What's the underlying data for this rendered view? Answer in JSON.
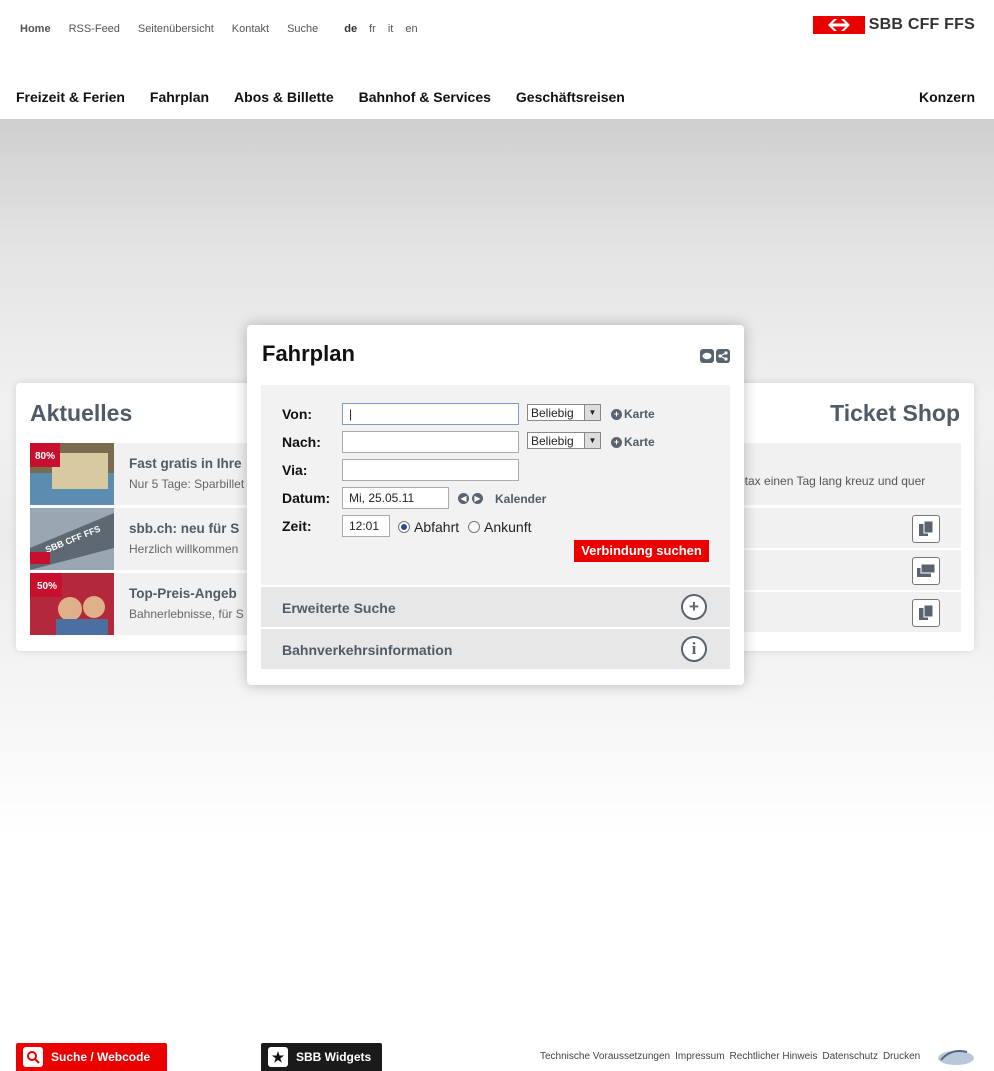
{
  "header": {
    "meta_links": [
      "Home",
      "RSS-Feed",
      "Seitenübersicht",
      "Kontakt",
      "Suche"
    ],
    "languages": [
      "de",
      "fr",
      "it",
      "en"
    ],
    "logo_text": "SBB CFF FFS"
  },
  "nav": {
    "items": [
      "Freizeit & Ferien",
      "Fahrplan",
      "Abos & Billette",
      "Bahnhof & Services",
      "Geschäftsreisen"
    ],
    "right": "Konzern"
  },
  "aktuelles": {
    "title": "Aktuelles",
    "items": [
      {
        "title": "Fast gratis in Ihre",
        "sub": "Nur 5 Tage: Sparbillet"
      },
      {
        "title": "sbb.ch: neu für S",
        "sub": "Herzlich willkommen"
      },
      {
        "title": "Top-Preis-Angeb",
        "sub": "Bahnerlebnisse, für S"
      }
    ]
  },
  "ticketshop": {
    "title": "Ticket Shop",
    "first_text": "ptax einen Tag lang kreuz und quer"
  },
  "fahrplan": {
    "title": "Fahrplan",
    "von_label": "Von:",
    "nach_label": "Nach:",
    "via_label": "Via:",
    "datum_label": "Datum:",
    "zeit_label": "Zeit:",
    "von_value": "|",
    "station_option": "Beliebig",
    "karte_label": "Karte",
    "datum_value": "Mi, 25.05.11",
    "kalender_label": "Kalender",
    "zeit_value": "12:01",
    "abfahrt_label": "Abfahrt",
    "ankunft_label": "Ankunft",
    "search_button": "Verbindung suchen",
    "erweitert_label": "Erweiterte Suche",
    "bahninfo_label": "Bahnverkehrsinformation"
  },
  "footer": {
    "search_label": "Suche / Webcode",
    "widgets_label": "SBB Widgets",
    "links": [
      "Technische Voraussetzungen",
      "Impressum",
      "Rechtlicher Hinweis",
      "Datenschutz",
      "Drucken"
    ]
  },
  "colors": {
    "brand_red": "#eb0000",
    "heading_grey": "#4f5b66"
  }
}
